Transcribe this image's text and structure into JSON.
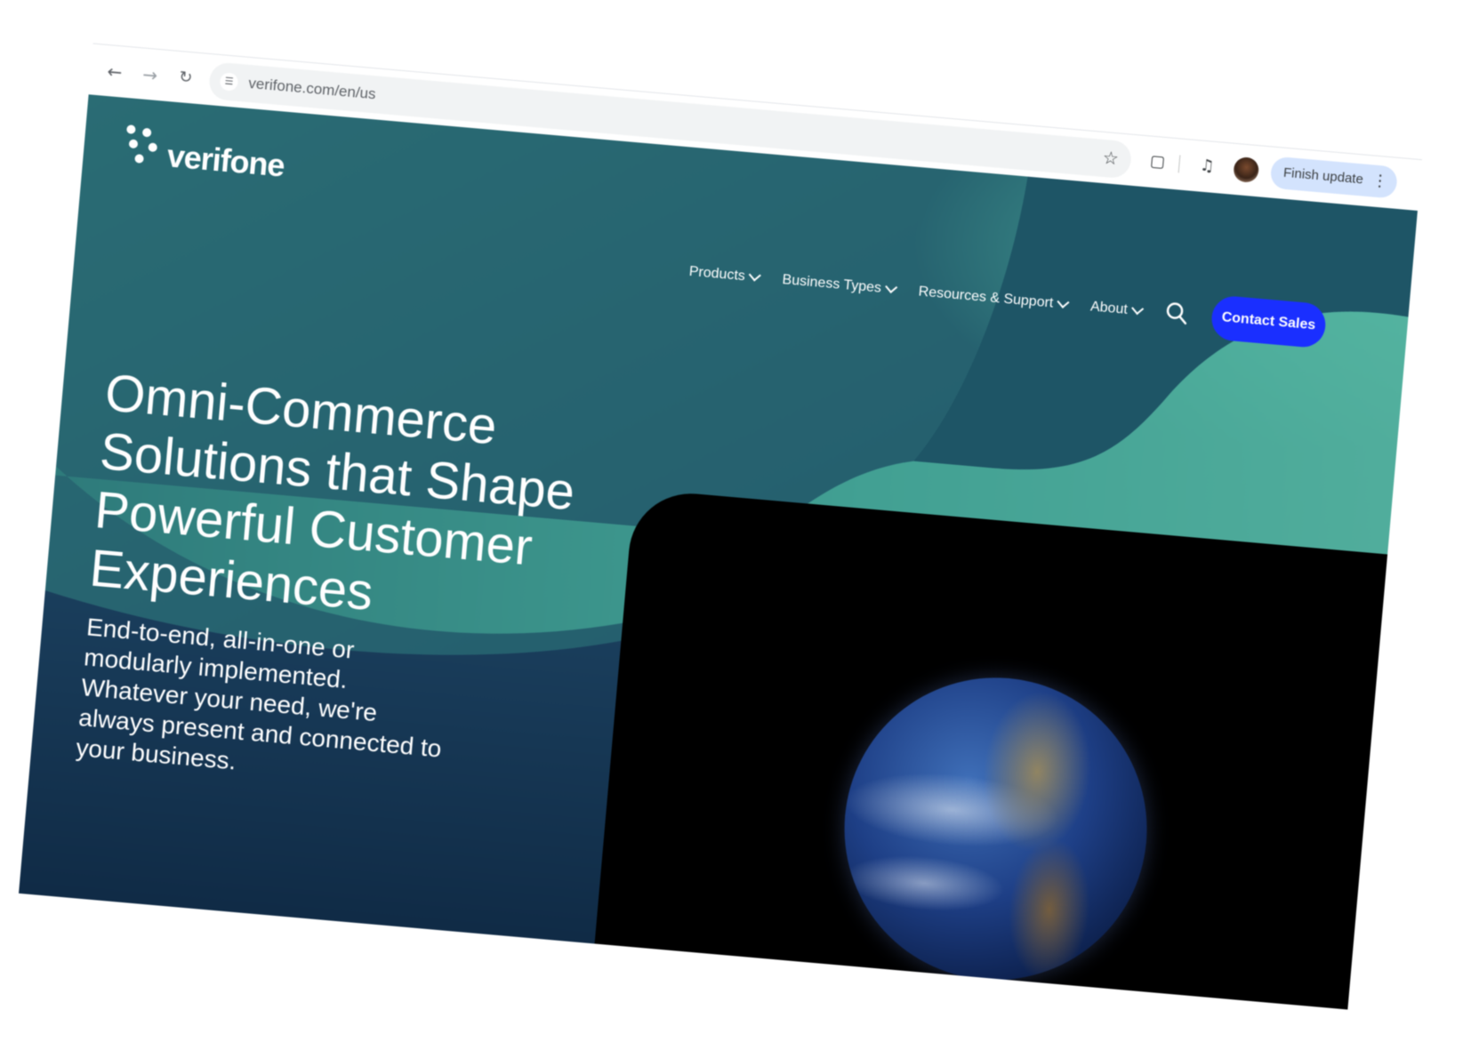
{
  "browser": {
    "url": "verifone.com/en/us",
    "finish_update_label": "Finish update",
    "icons": {
      "back": "arrow-left-icon",
      "forward": "arrow-right-icon",
      "reload": "reload-icon",
      "site_info": "tune-icon",
      "bookmark": "star-icon",
      "extensions": "puzzle-icon",
      "media": "media-control-icon",
      "menu": "more-vert-icon"
    }
  },
  "site": {
    "logo_text": "verifone",
    "nav": {
      "products": "Products",
      "business_types": "Business Types",
      "resources_support": "Resources & Support",
      "about": "About"
    },
    "contact_sales": "Contact Sales"
  },
  "hero": {
    "title": "Omni-Commerce Solutions that Shape Powerful Customer Experiences",
    "subtitle": "End-to-end, all-in-one or modularly implemented. Whatever your need, we're always present and connected to your business."
  },
  "colors": {
    "accent_button": "#1a2fff",
    "hero_dark": "#143552",
    "hero_teal": "#3fa695",
    "update_chip": "#d3e3fd"
  }
}
